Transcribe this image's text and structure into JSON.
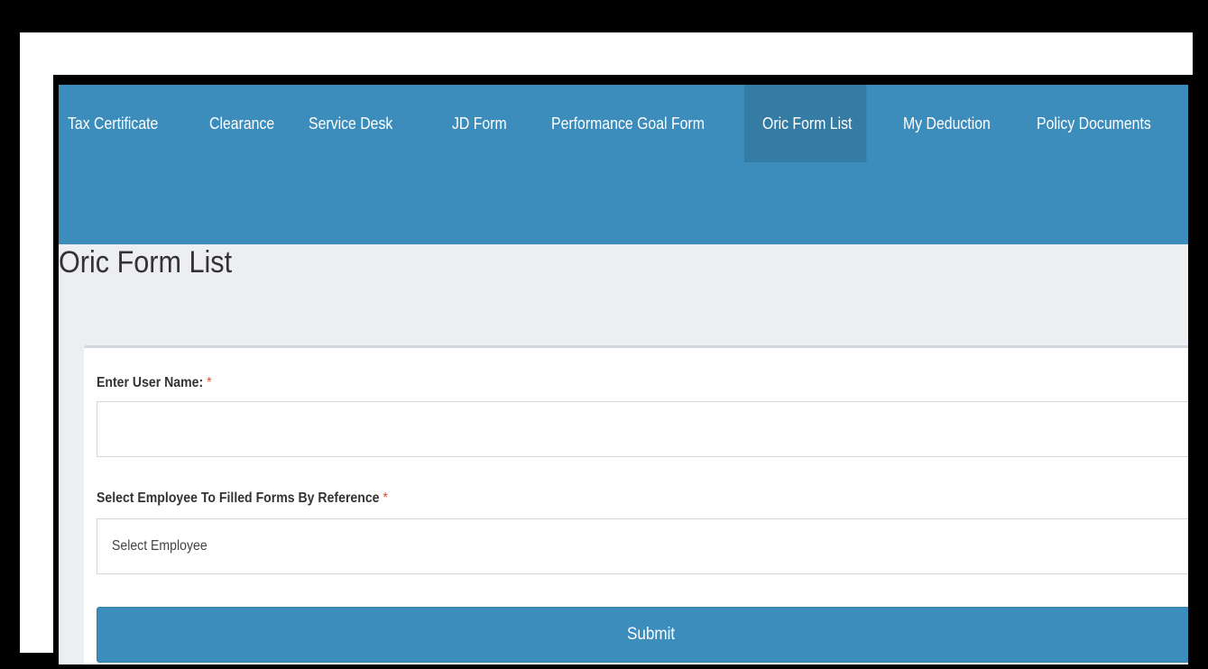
{
  "nav": {
    "items": [
      {
        "label": "Tax Certificate"
      },
      {
        "label": "Clearance"
      },
      {
        "label": "Service Desk"
      },
      {
        "label": "JD Form"
      },
      {
        "label": "Performance Goal Form"
      },
      {
        "label": "Oric Form List",
        "active": true
      },
      {
        "label": "My Deduction"
      },
      {
        "label": "Policy Documents"
      }
    ]
  },
  "page": {
    "title": "Oric Form List"
  },
  "form": {
    "username_label": "Enter User Name:",
    "required_mark": "*",
    "username_value": "",
    "employee_label": "Select Employee To Filled Forms By Reference",
    "employee_selected": "Select Employee",
    "submit_label": "Submit"
  },
  "colors": {
    "navbar": "#3c8dbc",
    "nav_active": "#357ca5",
    "required": "#dd4b39",
    "content_bg": "#eceef2"
  }
}
